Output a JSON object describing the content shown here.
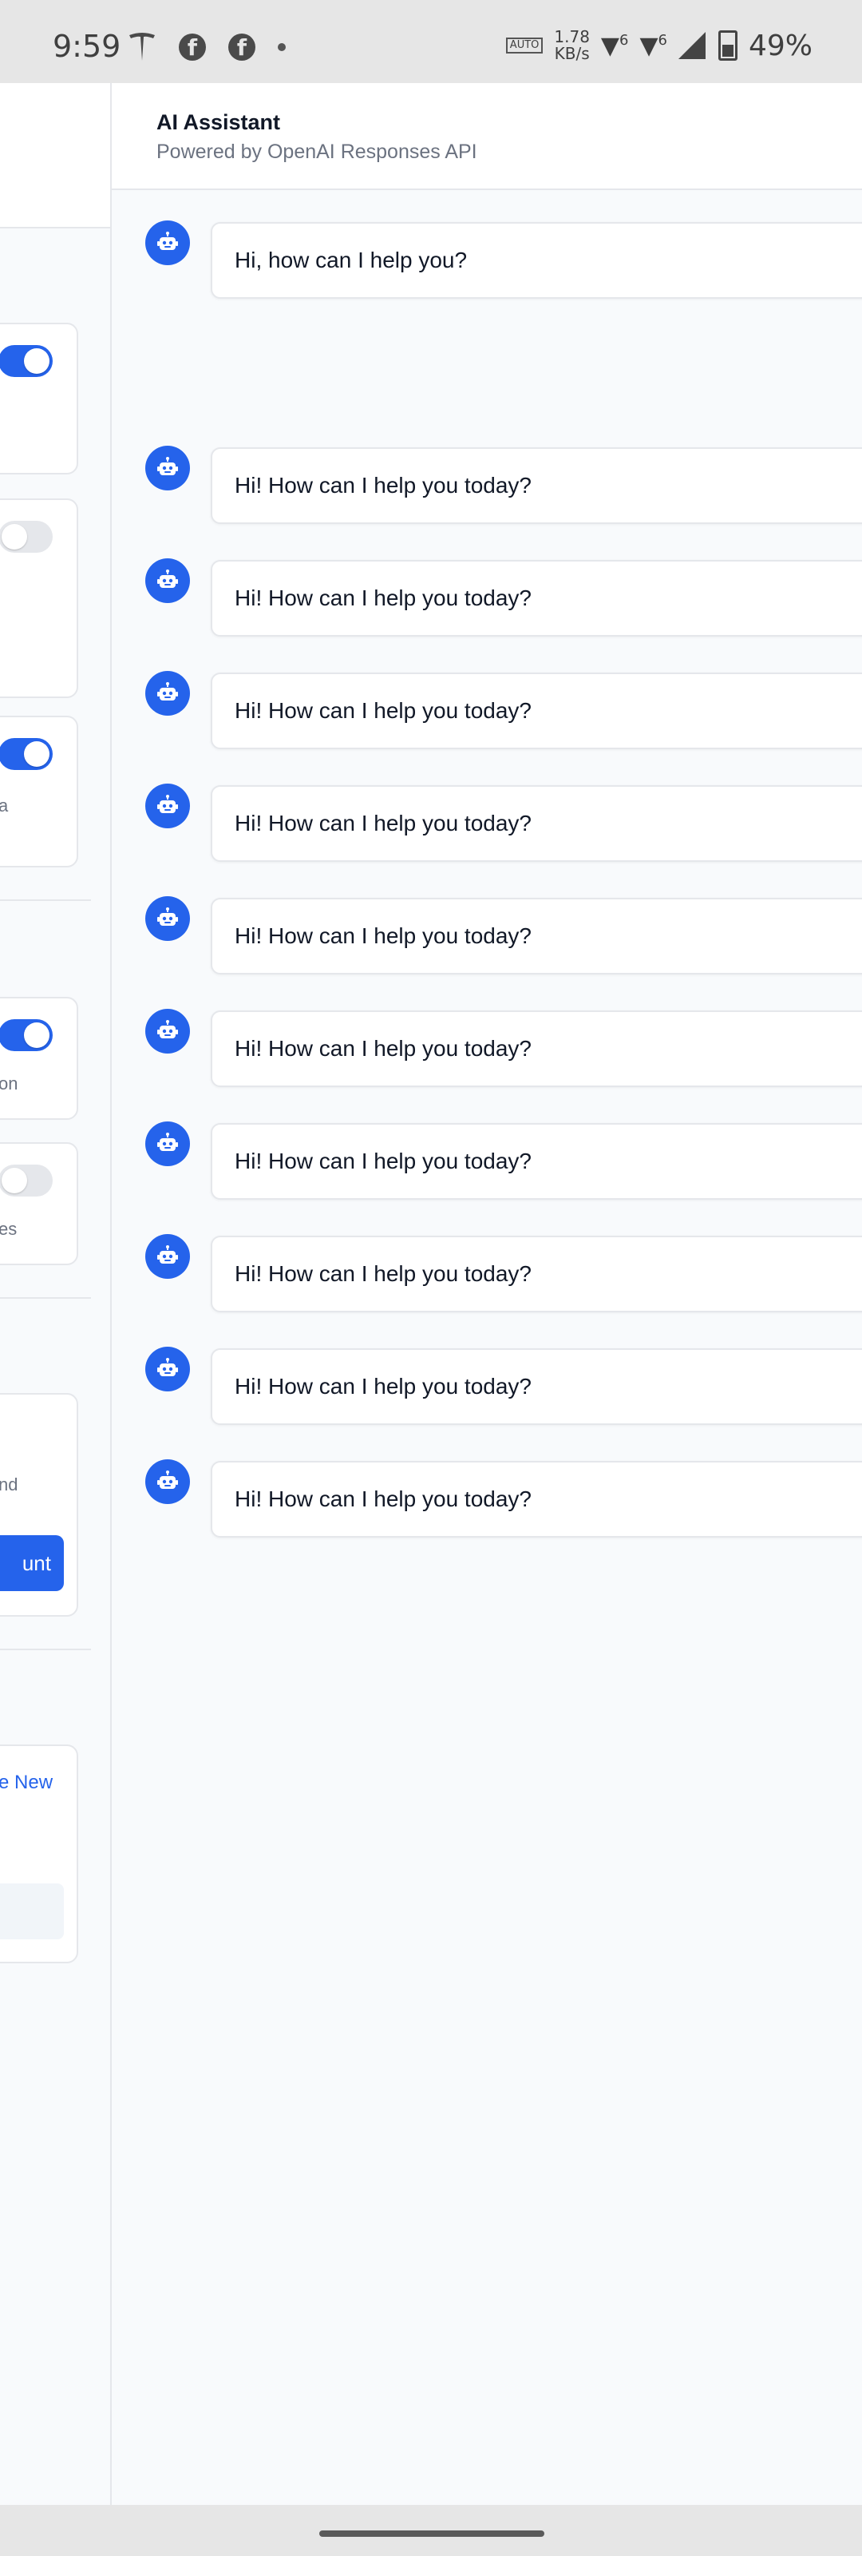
{
  "status_bar": {
    "time": "9:59",
    "auto_label": "AUTO",
    "speed_value": "1.78",
    "speed_unit": "KB/s",
    "net1": "6",
    "net2": "6",
    "battery": "49%"
  },
  "left_panel": {
    "text_a": "a",
    "text_on": "on",
    "text_es": "es",
    "text_nd": "nd",
    "button_partial": "unt",
    "link_partial": "e New",
    "toggles": [
      "on",
      "off",
      "on",
      "on",
      "off"
    ]
  },
  "chat": {
    "title": "AI Assistant",
    "subtitle": "Powered by OpenAI Responses API",
    "messages": [
      {
        "sender": "assistant",
        "text": "Hi, how can I help you?"
      },
      {
        "sender": "assistant",
        "text": "Hi! How can I help you today?"
      },
      {
        "sender": "assistant",
        "text": "Hi! How can I help you today?"
      },
      {
        "sender": "assistant",
        "text": "Hi! How can I help you today?"
      },
      {
        "sender": "assistant",
        "text": "Hi! How can I help you today?"
      },
      {
        "sender": "assistant",
        "text": "Hi! How can I help you today?"
      },
      {
        "sender": "assistant",
        "text": "Hi! How can I help you today?"
      },
      {
        "sender": "assistant",
        "text": "Hi! How can I help you today?"
      },
      {
        "sender": "assistant",
        "text": "Hi! How can I help you today?"
      },
      {
        "sender": "assistant",
        "text": "Hi! How can I help you today?"
      },
      {
        "sender": "assistant",
        "text": "Hi! How can I help you today?"
      }
    ]
  },
  "colors": {
    "accent": "#2563eb",
    "border": "#e5e7eb",
    "background": "#f8fafc"
  },
  "icons": {
    "avatar": "robot-icon"
  }
}
